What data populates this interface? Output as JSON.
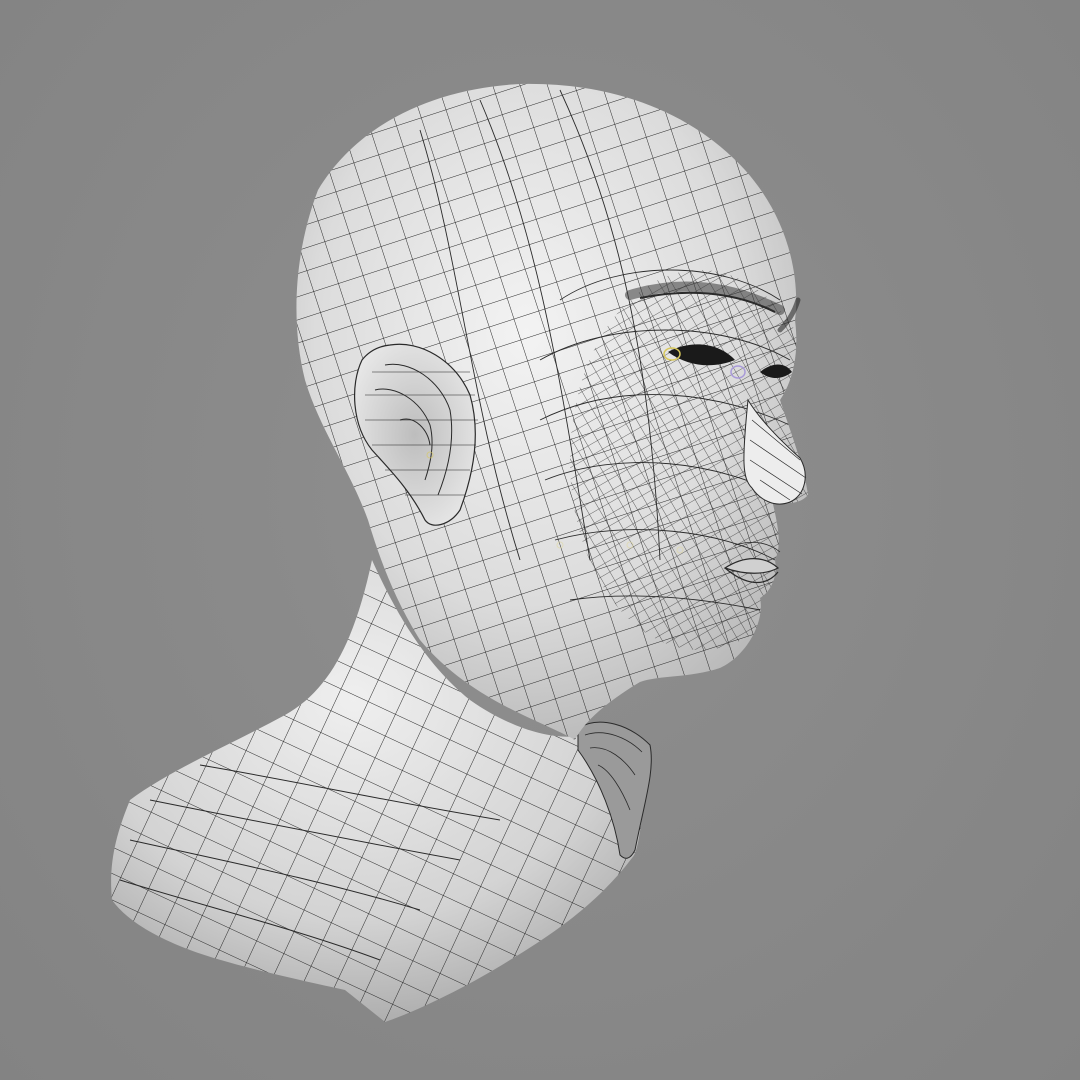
{
  "scene": {
    "background_color": "#8a8a8a",
    "model": {
      "name": "head-and-neck-wireframe-mesh",
      "surface_color": "#e6e6e6",
      "wire_color": "#1e1e1e"
    }
  }
}
